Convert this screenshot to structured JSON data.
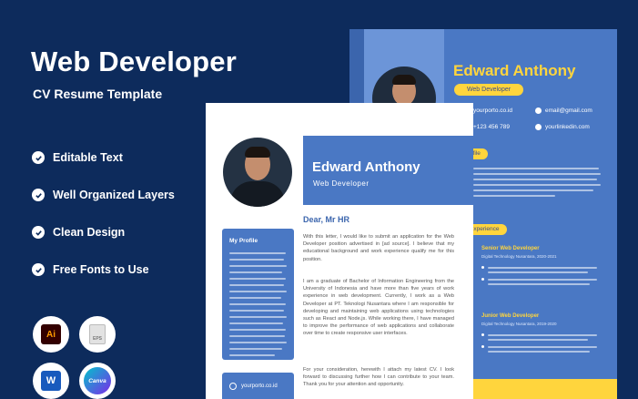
{
  "promo": {
    "title": "Web Developer",
    "subtitle": "CV Resume Template",
    "features": [
      "Editable Text",
      "Well Organized Layers",
      "Clean Design",
      "Free Fonts to Use"
    ],
    "apps": [
      {
        "name": "illustrator-icon",
        "label": "Ai",
        "bg": "#330000",
        "fg": "#ff9a00"
      },
      {
        "name": "eps-icon",
        "label": "EPS",
        "bg": "#e8e8e8",
        "fg": "#777"
      },
      {
        "name": "word-icon",
        "label": "W",
        "bg": "#185abd",
        "fg": "#ffffff"
      },
      {
        "name": "canva-icon",
        "label": "Canva",
        "bg": "#00c4cc",
        "fg": "#ffffff"
      }
    ]
  },
  "resume_back": {
    "name": "Edward Anthony",
    "role": "Web Developer",
    "phone": "+123 456 789",
    "website": "yourporto.co.id",
    "email": "email@gmail.com",
    "linkedin": "yourlinkedin.com",
    "section_profile": "ofile",
    "section_experience": "Experience",
    "jobs": [
      {
        "title": "Senior Web Developer",
        "company": "Digital Technology Nusantara, 2020-2021"
      },
      {
        "title": "Junior Web Developer",
        "company": "Digital Technology Nusantara, 2019-2020"
      }
    ]
  },
  "resume_front": {
    "name": "Edward Anthony",
    "role": "Web Developer",
    "sidebar_title": "My Profile",
    "website": "yourporto.co.id",
    "greeting": "Dear, Mr HR",
    "paragraphs": [
      "With this letter, I would like to submit an application for the Web Developer position advertised in [ad source]. I believe that my educational background and work experience qualify me for this position.",
      "I am a graduate of Bachelor of Information Engineering from the University of Indonesia and have more than five years of work experience in web development. Currently, I work as a Web Developer at PT. Teknologi Nusantara where I am responsible for developing and maintaining web applications using technologies such as React and Node.js. While working there, I have managed to improve the performance of web applications and collaborate over time to create responsive user interfaces.",
      "For your consideration, herewith I attach my latest CV. I look forward to discussing further how I can contribute to your team. Thank you for your attention and opportunity."
    ]
  },
  "colors": {
    "background": "#0d2b5c",
    "accent_blue": "#4a78c4",
    "accent_yellow": "#ffd53d"
  }
}
